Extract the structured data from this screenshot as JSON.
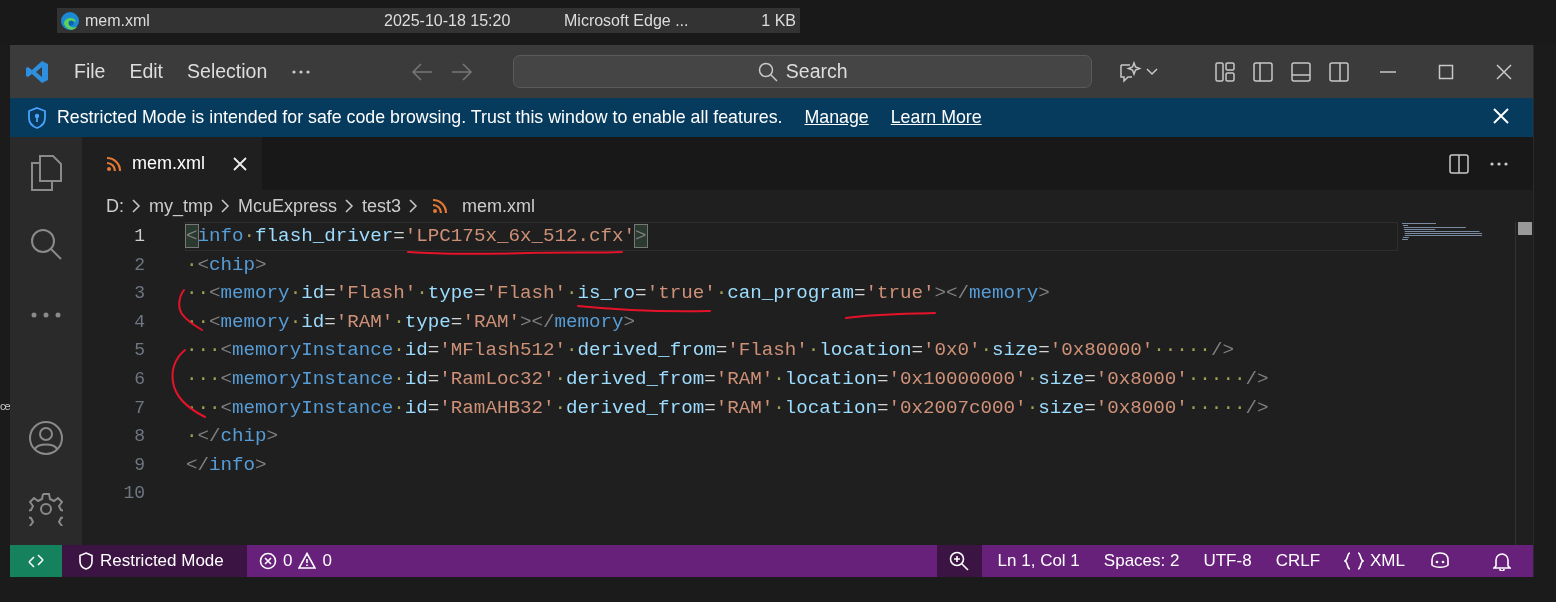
{
  "background_explorer": {
    "rows": [
      {
        "name": "mem.xml",
        "date": "2025-10-18 15:20",
        "type": "Microsoft Edge ...",
        "size": "1 KB",
        "selected": true
      }
    ],
    "fragment": "ce"
  },
  "window": {
    "menu": [
      "File",
      "Edit",
      "Selection"
    ],
    "command_center": {
      "label": "Search"
    }
  },
  "banner": {
    "message": "Restricted Mode is intended for safe code browsing. Trust this window to enable all features.",
    "links": [
      "Manage",
      "Learn More"
    ]
  },
  "tabs": [
    {
      "label": "mem.xml",
      "selected": true
    }
  ],
  "breadcrumbs": [
    "D:",
    "my_tmp",
    "McuExpress",
    "test3",
    "mem.xml"
  ],
  "editor": {
    "lines": [
      {
        "number": "1",
        "current": true,
        "text": "<info·flash_driver='LPC175x_6x_512.cfx'>"
      },
      {
        "number": "2",
        "current": false,
        "text": "·<chip>"
      },
      {
        "number": "3",
        "current": false,
        "text": "··<memory·id='Flash'·type='Flash'·is_ro='true'·can_program='true'></memory>"
      },
      {
        "number": "4",
        "current": false,
        "text": "··<memory·id='RAM'·type='RAM'></memory>"
      },
      {
        "number": "5",
        "current": false,
        "text": "···<memoryInstance·id='MFlash512'·derived_from='Flash'·location='0x0'·size='0x80000'·····/>"
      },
      {
        "number": "6",
        "current": false,
        "text": "···<memoryInstance·id='RamLoc32'·derived_from='RAM'·location='0x10000000'·size='0x8000'·····/>"
      },
      {
        "number": "7",
        "current": false,
        "text": "···<memoryInstance·id='RamAHB32'·derived_from='RAM'·location='0x2007c000'·size='0x8000'·····/>"
      },
      {
        "number": "8",
        "current": false,
        "text": "·</chip>"
      },
      {
        "number": "9",
        "current": false,
        "text": "</info>"
      },
      {
        "number": "10",
        "current": false
      }
    ]
  },
  "status_bar": {
    "mode": "Restricted Mode",
    "errors": "0",
    "warnings": "0",
    "items": [
      "Ln 1, Col 1",
      "Spaces: 2",
      "UTF-8",
      "CRLF"
    ],
    "language": "XML"
  }
}
